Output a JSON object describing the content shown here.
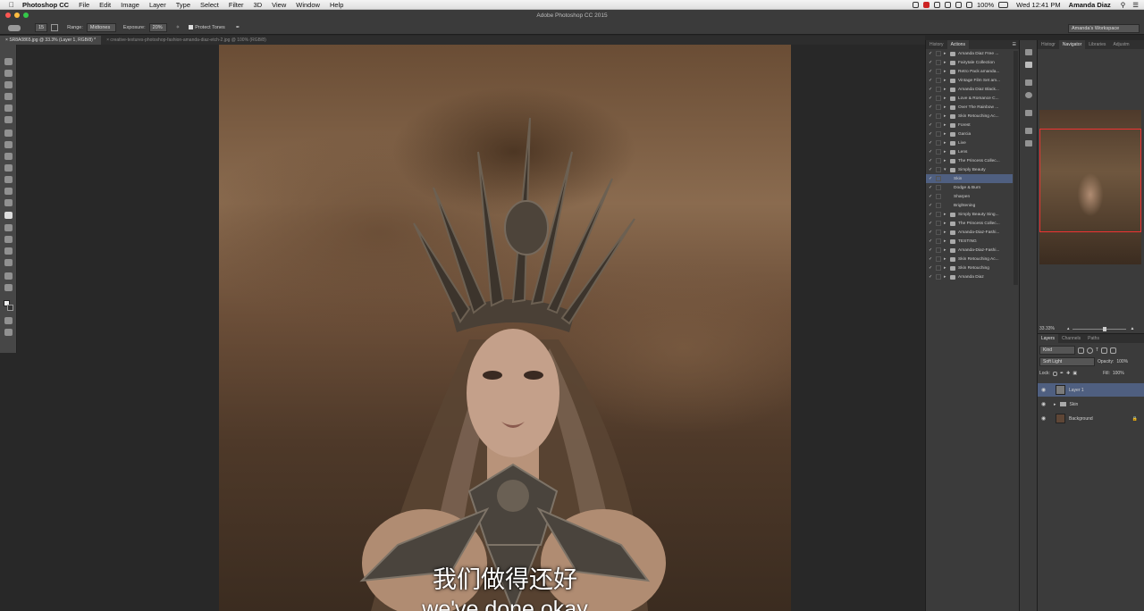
{
  "menubar": {
    "app_name": "Photoshop CC",
    "items": [
      "File",
      "Edit",
      "Image",
      "Layer",
      "Type",
      "Select",
      "Filter",
      "3D",
      "View",
      "Window",
      "Help"
    ],
    "battery": "100%",
    "clock": "Wed 12:41 PM",
    "user": "Amanda Diaz"
  },
  "window": {
    "title": "Adobe Photoshop CC 2015",
    "workspace": "Amanda's Workspace"
  },
  "options": {
    "brush_size": "15",
    "range_label": "Range:",
    "range_value": "Midtones",
    "exposure_label": "Exposure:",
    "exposure_value": "20%",
    "protect_tones": "Protect Tones"
  },
  "doc_tabs": [
    "SR8A0865.jpg @ 33.3% (Layer 1, RGB/8) *",
    "creative-textures-photoshop-fashion-amanda-diaz-etch-2.jpg @ 100% (RGB/8)"
  ],
  "actions_panel": {
    "tabs": [
      "History",
      "Actions"
    ],
    "rows": [
      {
        "label": "Amanda Diaz Free ..."
      },
      {
        "label": "Fairytale Collection"
      },
      {
        "label": "Retro Pack amanda..."
      },
      {
        "label": "Vintage Film Set am..."
      },
      {
        "label": "Amanda Diaz Black..."
      },
      {
        "label": "Love & Romance C..."
      },
      {
        "label": "Over The Rainbow ..."
      },
      {
        "label": "Skin Retouching Ac..."
      },
      {
        "label": "Forest"
      },
      {
        "label": "Garcia"
      },
      {
        "label": "Live"
      },
      {
        "label": "Lens"
      },
      {
        "label": "The Princess Collec..."
      },
      {
        "label": "Simply Beauty"
      },
      {
        "label": "Skin"
      },
      {
        "label": "Dodge & Burn"
      },
      {
        "label": "Sharpen"
      },
      {
        "label": "Brightening"
      },
      {
        "label": "Simply Beauty Sing..."
      },
      {
        "label": "The Princess Collec..."
      },
      {
        "label": "Amanda-Diaz-Fashi..."
      },
      {
        "label": "TESTING"
      },
      {
        "label": "Amanda-Diaz-Fashi..."
      },
      {
        "label": "Skin Retouching Ac..."
      },
      {
        "label": "Skin Retouching"
      },
      {
        "label": "Amanda Diaz"
      }
    ]
  },
  "navigator": {
    "tabs": [
      "Histogr",
      "Navigator",
      "Libraries",
      "Adjustm"
    ],
    "zoom": "33.33%"
  },
  "layers": {
    "tabs": [
      "Layers",
      "Channels",
      "Paths"
    ],
    "filter": "Kind",
    "blend_mode": "Soft Light",
    "opacity_label": "Opacity:",
    "opacity": "100%",
    "lock_label": "Lock:",
    "fill_label": "Fill:",
    "fill": "100%",
    "items": [
      {
        "name": "Layer 1"
      },
      {
        "name": "Skin"
      },
      {
        "name": "Background"
      }
    ]
  },
  "subtitles": {
    "line1": "我们做得还好",
    "line2": "we've done okay"
  },
  "colors": {
    "selection": "#4f5f80",
    "panel": "#3b3b3b"
  }
}
